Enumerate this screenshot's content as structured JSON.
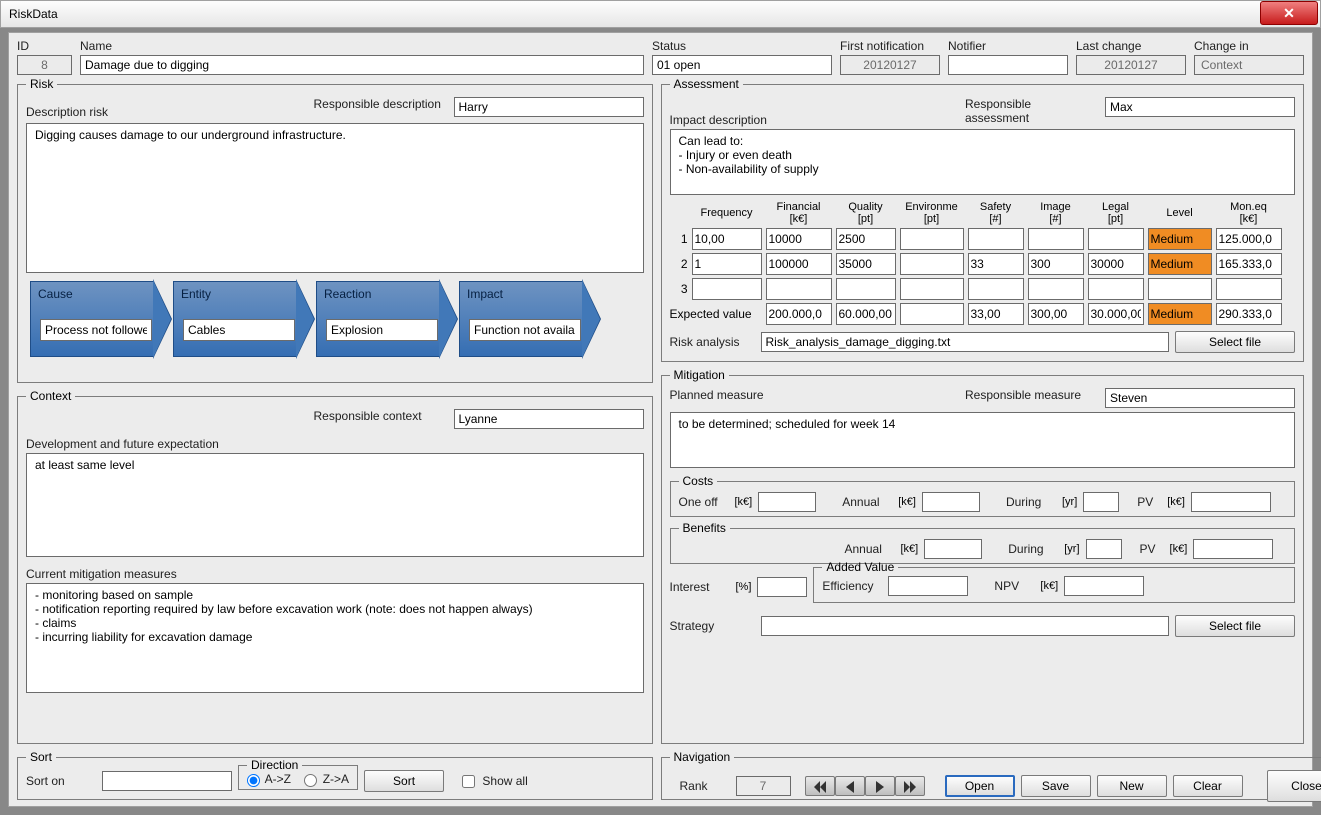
{
  "title": "RiskData",
  "header": {
    "id_label": "ID",
    "id_value": "8",
    "name_label": "Name",
    "name_value": "Damage due to digging",
    "status_label": "Status",
    "status_value": "01 open",
    "firstnot_label": "First notification",
    "firstnot_value": "20120127",
    "notifier_label": "Notifier",
    "notifier_value": "",
    "lastchange_label": "Last change",
    "lastchange_value": "20120127",
    "changein_label": "Change in",
    "changein_value": "Context"
  },
  "risk": {
    "legend": "Risk",
    "resp_label": "Responsible description",
    "resp_value": "Harry",
    "desc_label": "Description risk",
    "desc_value": "Digging causes damage to our underground infrastructure.",
    "chain": {
      "cause_label": "Cause",
      "cause_value": "Process not followe",
      "entity_label": "Entity",
      "entity_value": "Cables",
      "reaction_label": "Reaction",
      "reaction_value": "Explosion",
      "impact_label": "Impact",
      "impact_value": "Function not availa"
    }
  },
  "context": {
    "legend": "Context",
    "resp_label": "Responsible context",
    "resp_value": "Lyanne",
    "dev_label": "Development and future expectation",
    "dev_value": "at least same level",
    "cur_label": "Current mitigation measures",
    "cur_value": "- monitoring based on sample\n- notification reporting required by law before excavation work (note: does not happen always)\n- claims\n- incurring liability for excavation damage"
  },
  "sort": {
    "legend": "Sort",
    "sorton_label": "Sort on",
    "sorton_value": "",
    "dir_legend": "Direction",
    "dir_az": "A->Z",
    "dir_za": "Z->A",
    "sort_btn": "Sort",
    "showall_label": "Show all"
  },
  "assessment": {
    "legend": "Assessment",
    "resp_label": "Responsible assessment",
    "resp_value": "Max",
    "impact_label": "Impact description",
    "impact_value": "Can lead to:\n- Injury or even death\n- Non-availability of supply",
    "cols": {
      "frequency": "Frequency",
      "financial": "Financial\n[k€]",
      "quality": "Quality\n[pt]",
      "environment": "Environme\n[pt]",
      "safety": "Safety\n[#]",
      "image": "Image\n[#]",
      "legal": "Legal\n[pt]",
      "level": "Level",
      "moneq": "Mon.eq\n[k€]"
    },
    "rows": [
      {
        "n": "1",
        "freq": "10,00",
        "fin": "10000",
        "qual": "2500",
        "env": "",
        "saf": "",
        "img": "",
        "leg": "",
        "lvl": "Medium",
        "mon": "125.000,0"
      },
      {
        "n": "2",
        "freq": "1",
        "fin": "100000",
        "qual": "35000",
        "env": "",
        "saf": "33",
        "img": "300",
        "leg": "30000",
        "lvl": "Medium",
        "mon": "165.333,0"
      },
      {
        "n": "3",
        "freq": "",
        "fin": "",
        "qual": "",
        "env": "",
        "saf": "",
        "img": "",
        "leg": "",
        "lvl": "",
        "mon": ""
      }
    ],
    "expected_label": "Expected value",
    "expected": {
      "fin": "200.000,0",
      "qual": "60.000,00",
      "env": "",
      "saf": "33,00",
      "img": "300,00",
      "leg": "30.000,00",
      "lvl": "Medium",
      "mon": "290.333,0"
    },
    "riskanalysis_label": "Risk analysis",
    "riskanalysis_value": "Risk_analysis_damage_digging.txt",
    "selectfile": "Select file"
  },
  "mitigation": {
    "legend": "Mitigation",
    "planned_label": "Planned measure",
    "resp_label": "Responsible measure",
    "resp_value": "Steven",
    "planned_value": "to be determined; scheduled for week 14",
    "costs": {
      "legend": "Costs",
      "oneoff": "One off",
      "annual": "Annual",
      "during": "During",
      "pv": "PV",
      "u_ke": "[k€]",
      "u_yr": "[yr]",
      "v_oneoff": "",
      "v_annual": "",
      "v_during": "",
      "v_pv": ""
    },
    "benefits": {
      "legend": "Benefits",
      "annual": "Annual",
      "during": "During",
      "pv": "PV",
      "u_ke": "[k€]",
      "u_yr": "[yr]",
      "v_annual": "",
      "v_during": "",
      "v_pv": ""
    },
    "interest_label": "Interest",
    "interest_unit": "[%]",
    "interest_value": "",
    "added": {
      "legend": "Added Value",
      "eff_label": "Efficiency",
      "eff_value": "",
      "npv_label": "NPV",
      "npv_unit": "[k€]",
      "npv_value": ""
    },
    "strategy_label": "Strategy",
    "strategy_value": "",
    "selectfile": "Select file"
  },
  "nav": {
    "legend": "Navigation",
    "rank_label": "Rank",
    "rank_value": "7",
    "open": "Open",
    "save": "Save",
    "new": "New",
    "clear": "Clear",
    "close": "Close"
  }
}
